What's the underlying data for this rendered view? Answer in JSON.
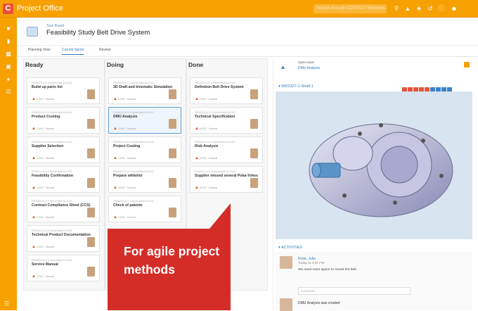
{
  "app": {
    "logo": "C",
    "title": "Project Office"
  },
  "search": {
    "placeholder": "Search through CONTACT Elements..."
  },
  "header": {
    "breadcrumb": "Task Board",
    "title": "Feasibility Study Belt Drive System"
  },
  "tabs": [
    {
      "label": "Planning View"
    },
    {
      "label": "Current Sprint"
    },
    {
      "label": "Review"
    }
  ],
  "columns": [
    {
      "label": "Ready"
    },
    {
      "label": "Doing"
    },
    {
      "label": "Done"
    }
  ],
  "cards": {
    "ready": [
      {
        "title": "Build up parts list",
        "status": "1.000 · Normal"
      },
      {
        "title": "Product Costing",
        "status": "1.000 · Normal"
      },
      {
        "title": "Supplier Selection",
        "status": "1.000 · Normal"
      },
      {
        "title": "Feasibility Confirmation",
        "status": "1.000 · Normal"
      },
      {
        "title": "Contract Compliance Sheet (CCS)",
        "status": "1.000 · Normal"
      },
      {
        "title": "Technical Product Documentation",
        "status": "1.000 · Normal"
      },
      {
        "title": "Service Manual",
        "status": "1.000 · Normal"
      }
    ],
    "doing": [
      {
        "title": "3D Draft and kinematic Simulation",
        "status": "2.000 · Normal"
      },
      {
        "title": "DMU Analysis",
        "status": "1.000 · Normal"
      },
      {
        "title": "Project Costing",
        "status": "1.000 · Normal"
      },
      {
        "title": "Prepare whitelist",
        "status": "1.000 · Normal"
      },
      {
        "title": "Check of patents",
        "status": "1.000 · Normal"
      }
    ],
    "done": [
      {
        "title": "Definition Belt Drive System",
        "status": "2.000 · Normal"
      },
      {
        "title": "Technical Specification",
        "status": "6.000 · Normal"
      },
      {
        "title": "Risk Analysis",
        "status": "6.000 · Normal"
      },
      {
        "title": "Supplier missed several Poka-Yokes",
        "status": "6.000 · Normal"
      }
    ]
  },
  "card_id": "P000221 A.0.4 Sprint Belt M-4743",
  "open_issue": {
    "label": "Open Issue",
    "link": "DMU Analysis"
  },
  "viewer": {
    "part": "9502327-1-Shaft.1"
  },
  "activities": {
    "title": "ACTIVITIES",
    "entries": [
      {
        "name": "Kmet, Julia",
        "meta": "Today at 4:01 PM",
        "message": "We need more space to mount the belt."
      },
      {
        "name": "DMU Analysis was created",
        "meta": "",
        "message": ""
      }
    ],
    "comment_placeholder": "Comment..."
  },
  "callout": {
    "text": "For agile project methods"
  },
  "colors": {
    "brand": "#f7a100",
    "accent": "#d42d28",
    "link": "#2f7ec2"
  }
}
